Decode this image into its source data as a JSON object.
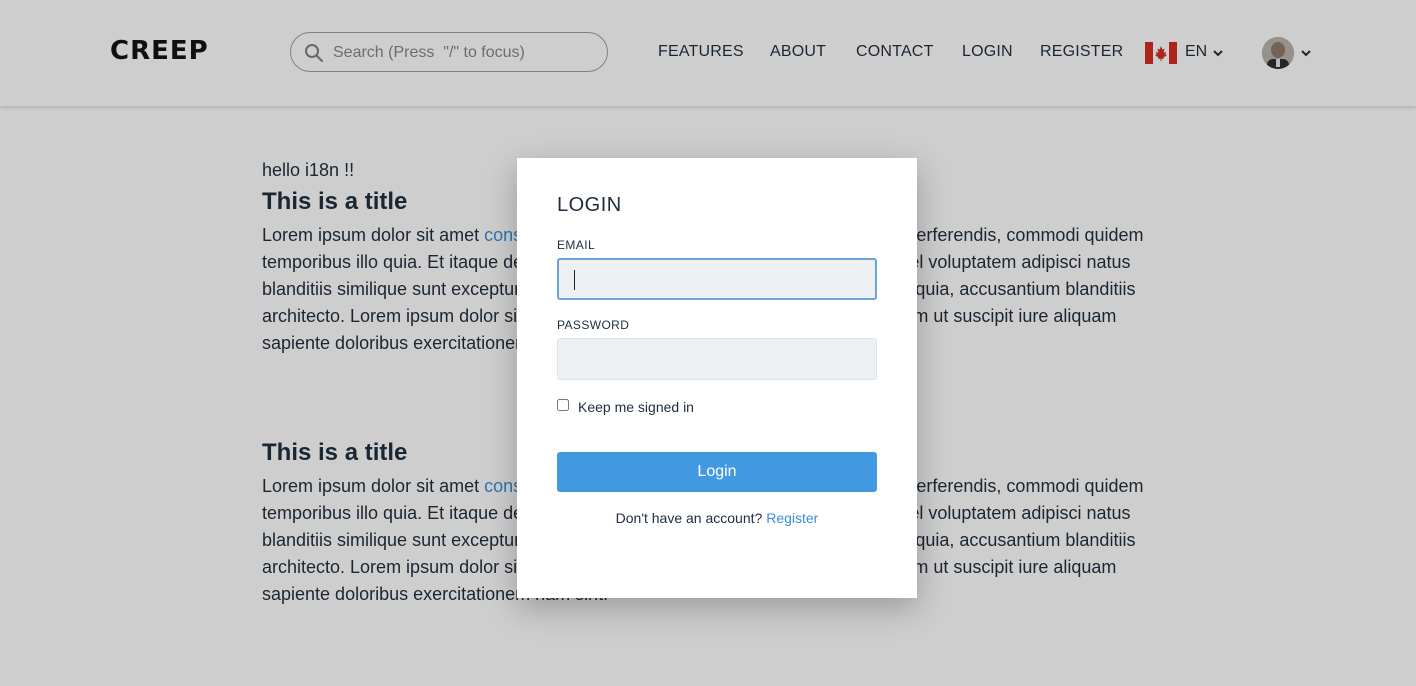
{
  "header": {
    "logo": "CREEP",
    "search_placeholder": "Search (Press  \"/\" to focus)",
    "nav": [
      "FEATURES",
      "ABOUT",
      "CONTACT",
      "LOGIN",
      "REGISTER"
    ],
    "language": "EN"
  },
  "content": {
    "greeting": "hello i18n !!",
    "sections": [
      {
        "title": "This is a title",
        "link_text": "consectetur adipisicing elit",
        "text_before_link": "Lorem ipsum dolor sit amet ",
        "text_after_link": ". Aspernatur et quo neque perferendis, commodi quidem temporibus illo quia. Et itaque deleniti veniam, omnis nulla nobis laborum soluta vel voluptatem adipisci natus blanditiis similique sunt excepturi doloribus deleniti possimus omnibus. Quisquam quia, accusantium blanditiis architecto. Lorem ipsum dolor sit amet consectetur adipisicing elit. Ad unde laborum ut suscipit iure aliquam sapiente doloribus exercitationem nam sint."
      },
      {
        "title": "This is a title",
        "link_text": "consectetur adipisicing elit",
        "text_before_link": "Lorem ipsum dolor sit amet ",
        "text_after_link": ". Aspernatur et quo neque perferendis, commodi quidem temporibus illo quia. Et itaque deleniti veniam, omnis nulla nobis laborum soluta vel voluptatem adipisci natus blanditiis similique sunt excepturi doloribus deleniti possimus omnibus. Quisquam quia, accusantium blanditiis architecto. Lorem ipsum dolor sit amet consectetur adipisicing elit. Ad unde laborum ut suscipit iure aliquam sapiente doloribus exercitationem nam sint."
      }
    ]
  },
  "modal": {
    "title": "LOGIN",
    "email_label": "EMAIL",
    "email_value": "",
    "password_label": "PASSWORD",
    "password_value": "",
    "remember_label": "Keep me signed in",
    "remember_checked": false,
    "submit_label": "Login",
    "no_account_text": "Don't have an account?",
    "register_link": "Register"
  },
  "colors": {
    "accent": "#4299e1",
    "link": "#3a8ed8",
    "text": "#1f2d3d",
    "overlay": "rgba(10,10,10,0.20)"
  },
  "icons": {
    "search": "search-icon",
    "flag": "canada-flag-icon",
    "chevron": "chevron-down-icon",
    "avatar": "avatar"
  }
}
